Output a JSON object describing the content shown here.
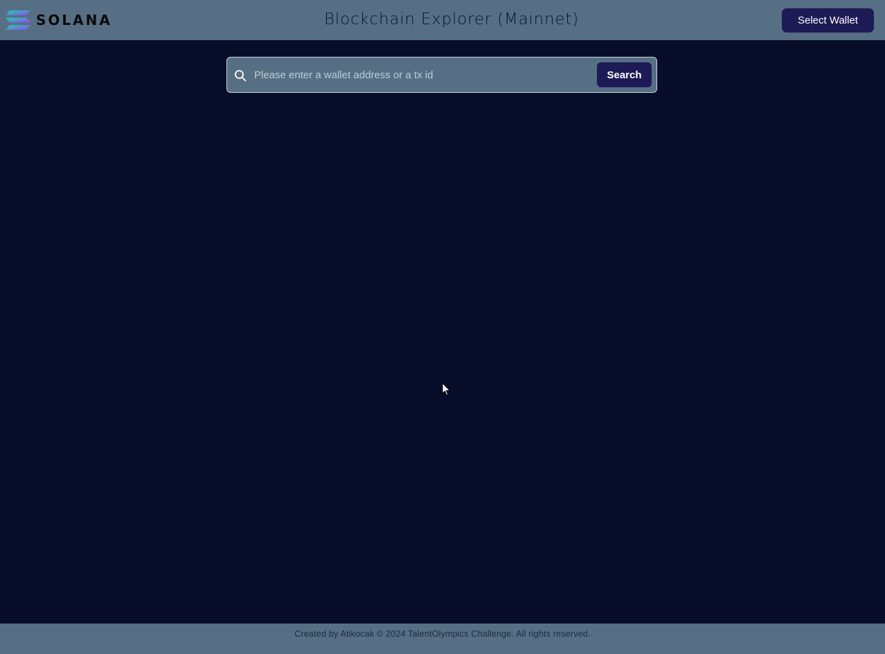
{
  "header": {
    "logo_text": "SOLANA",
    "title": "Blockchain Explorer (Mainnet)",
    "wallet_button_label": "Select Wallet"
  },
  "search": {
    "placeholder": "Please enter a wallet address or a tx id",
    "value": "",
    "button_label": "Search"
  },
  "footer": {
    "text": "Created by Atikocak © 2024 TalentOlympics Challenge. All rights reserved."
  },
  "icons": {
    "logo": "solana-logo-icon",
    "search": "search-icon",
    "cursor": "mouse-cursor-icon"
  },
  "colors": {
    "background": "#070d29",
    "bar": "#566f85",
    "button": "#1d1a55",
    "logo_gradient_start": "#19d3a2",
    "logo_gradient_end": "#9945ff"
  }
}
